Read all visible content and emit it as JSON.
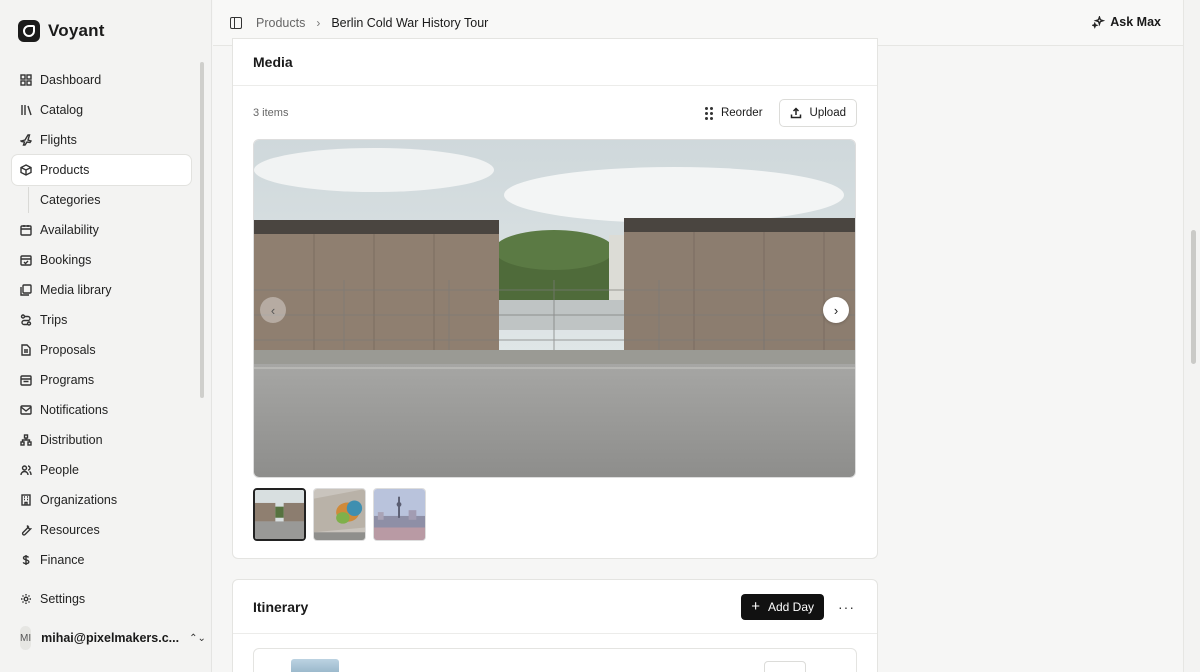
{
  "brand": {
    "name": "Voyant"
  },
  "sidebar": {
    "items": [
      {
        "label": "Dashboard",
        "icon": "dashboard-icon"
      },
      {
        "label": "Catalog",
        "icon": "catalog-icon"
      },
      {
        "label": "Flights",
        "icon": "plane-icon"
      },
      {
        "label": "Products",
        "icon": "box-icon",
        "active": true
      },
      {
        "label": "Categories",
        "sub": true
      },
      {
        "label": "Availability",
        "icon": "calendar-icon"
      },
      {
        "label": "Bookings",
        "icon": "calendar-check-icon"
      },
      {
        "label": "Media library",
        "icon": "images-icon"
      },
      {
        "label": "Trips",
        "icon": "route-icon"
      },
      {
        "label": "Proposals",
        "icon": "document-icon"
      },
      {
        "label": "Programs",
        "icon": "calendar-list-icon"
      },
      {
        "label": "Notifications",
        "icon": "mail-icon"
      },
      {
        "label": "Distribution",
        "icon": "network-icon"
      },
      {
        "label": "People",
        "icon": "people-icon"
      },
      {
        "label": "Organizations",
        "icon": "building-icon"
      },
      {
        "label": "Resources",
        "icon": "wrench-icon"
      },
      {
        "label": "Finance",
        "icon": "dollar-icon"
      }
    ],
    "settings_label": "Settings",
    "user": {
      "initials": "MI",
      "email": "mihai@pixelmakers.c..."
    }
  },
  "topbar": {
    "breadcrumb_parent": "Products",
    "breadcrumb_current": "Berlin Cold War History Tour",
    "ask_label": "Ask Max"
  },
  "media": {
    "title": "Media",
    "count": "3 items",
    "reorder_label": "Reorder",
    "upload_label": "Upload",
    "thumbnails": [
      "berlin-wall",
      "east-side-gallery-mural",
      "berlin-skyline"
    ],
    "selected_index": 0
  },
  "itinerary": {
    "title": "Itinerary",
    "add_day_label": "Add Day",
    "more_label": "···"
  }
}
